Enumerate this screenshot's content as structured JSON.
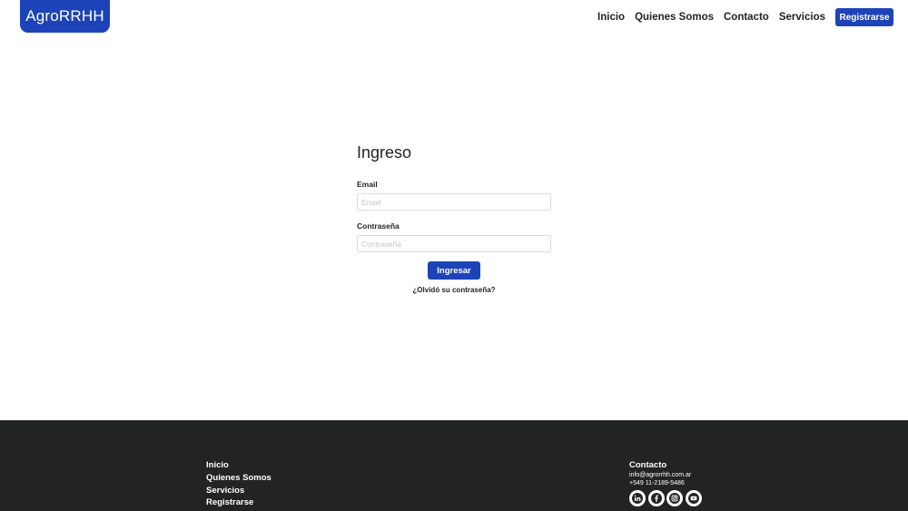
{
  "header": {
    "logo": "AgroRRHH",
    "nav": [
      "Inicio",
      "Quienes Somos",
      "Contacto",
      "Servicios"
    ],
    "cta": "Registrarse"
  },
  "login": {
    "title": "Ingreso",
    "email_label": "Email",
    "email_placeholder": "Email",
    "password_label": "Contraseña",
    "password_placeholder": "Contraseña",
    "submit": "Ingresar",
    "forgot": "¿Olvidó su contraseña?"
  },
  "footer": {
    "links": [
      "Inicio",
      "Quienes Somos",
      "Servicios",
      "Registrarse"
    ],
    "contact_title": "Contacto",
    "email": "info@agrorrhh.com.ar",
    "phone": "+549 11-2189-5486",
    "socials": [
      "linkedin-icon",
      "facebook-icon",
      "instagram-icon",
      "youtube-icon"
    ]
  },
  "colors": {
    "brand": "#1d43b8",
    "footer_bg": "#222325"
  }
}
